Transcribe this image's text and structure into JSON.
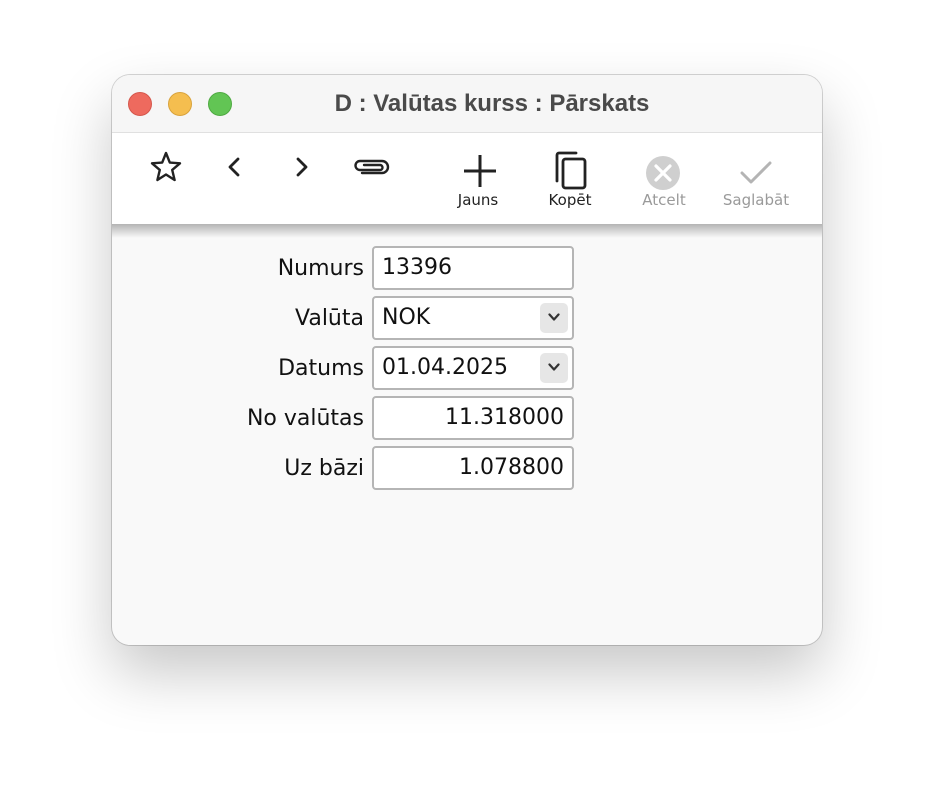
{
  "window": {
    "title": "D : Valūtas kurss : Pārskats"
  },
  "toolbar": {
    "favorite_icon": "star-icon",
    "back_icon": "chevron-left-icon",
    "forward_icon": "chevron-right-icon",
    "attach_icon": "paperclip-icon",
    "new_label": "Jauns",
    "copy_label": "Kopēt",
    "cancel_label": "Atcelt",
    "save_label": "Saglabāt"
  },
  "form": {
    "number": {
      "label": "Numurs",
      "value": "13396"
    },
    "currency": {
      "label": "Valūta",
      "value": "NOK"
    },
    "date": {
      "label": "Datums",
      "value": "01.04.2025"
    },
    "from_currency": {
      "label": "No valūtas",
      "value": "11.318000"
    },
    "to_base": {
      "label": "Uz bāzi",
      "value": "1.078800"
    }
  },
  "colors": {
    "close": "#ee6a5e",
    "minimize": "#f5be4f",
    "zoom": "#62c554",
    "disabled_text": "#9a9a9a"
  }
}
